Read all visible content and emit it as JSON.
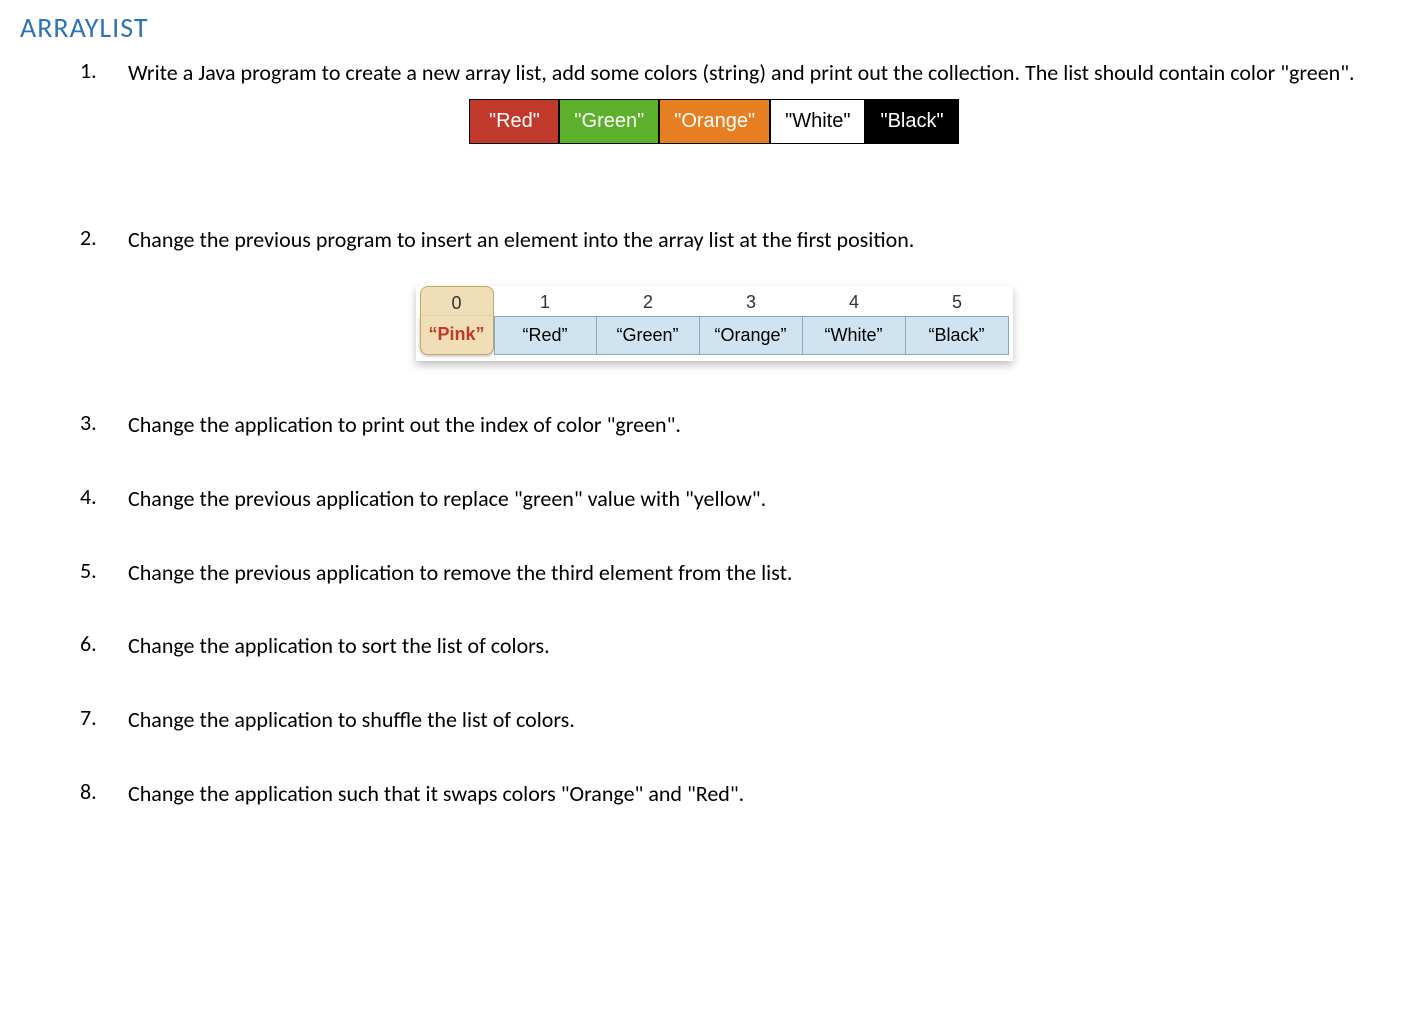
{
  "title": "ARRAYLIST",
  "questions": [
    {
      "num": "1.",
      "text": "Write a Java program to create a new array list, add some colors (string) and print out the collection. The list should contain color \"green\"."
    },
    {
      "num": "2.",
      "text": "Change the previous program to insert an element into the array list at the first position."
    },
    {
      "num": "3.",
      "text": "Change the application to print out the index of color \"green\"."
    },
    {
      "num": "4.",
      "text": "Change the previous application to replace \"green\" value with \"yellow\"."
    },
    {
      "num": "5.",
      "text": "Change the previous application to remove the third element from the list."
    },
    {
      "num": "6.",
      "text": "Change the application to sort the list of colors."
    },
    {
      "num": "7.",
      "text": "Change the application to shuffle the list of colors."
    },
    {
      "num": "8.",
      "text": "Change the application such that it swaps colors \"Orange\" and \"Red\"."
    }
  ],
  "diagram1": {
    "boxes": [
      {
        "label": "\"Red\"",
        "cls": "box-red"
      },
      {
        "label": "\"Green\"",
        "cls": "box-green"
      },
      {
        "label": "\"Orange\"",
        "cls": "box-orange"
      },
      {
        "label": "\"White\"",
        "cls": "box-white"
      },
      {
        "label": "\"Black\"",
        "cls": "box-black"
      }
    ]
  },
  "diagram2": {
    "indices": [
      "0",
      "1",
      "2",
      "3",
      "4",
      "5"
    ],
    "values": [
      "“Pink”",
      "“Red”",
      "“Green”",
      "“Orange”",
      "“White”",
      "“Black”"
    ]
  }
}
